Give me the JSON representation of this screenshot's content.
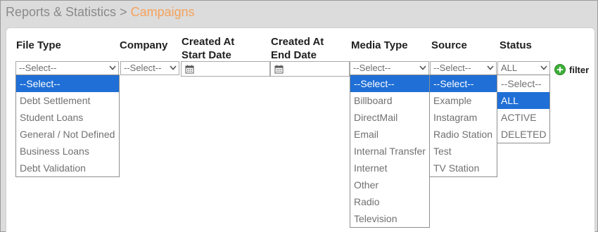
{
  "breadcrumb": {
    "parent": "Reports & Statistics",
    "separator": ">",
    "current": "Campaigns"
  },
  "columns": {
    "file_type": "File Type",
    "company": "Company",
    "created_start_line1": "Created At",
    "created_start_line2": "Start Date",
    "created_end_line1": "Created At",
    "created_end_line2": "End Date",
    "media_type": "Media Type",
    "source": "Source",
    "status": "Status"
  },
  "selects": {
    "file_type": "--Select--",
    "company": "--Select--",
    "media_type": "--Select--",
    "source": "--Select--",
    "status": "ALL"
  },
  "dropdowns": {
    "file_type": [
      "--Select--",
      "Debt Settlement",
      "Student Loans",
      "General / Not Defined",
      "Business Loans",
      "Debt Validation"
    ],
    "media_type": [
      "--Select--",
      "Billboard",
      "DirectMail",
      "Email",
      "Internal Transfer",
      "Internet",
      "Other",
      "Radio",
      "Television"
    ],
    "source": [
      "--Select--",
      "Example",
      "Instagram",
      "Radio Station",
      "Test",
      "TV Station"
    ],
    "status": [
      "--Select--",
      "ALL",
      "ACTIVE",
      "DELETED"
    ]
  },
  "filter_label": "filter",
  "colors": {
    "accent": "#f5a25b",
    "selected": "#1f6fd6",
    "filter_icon": "#3fae3a"
  }
}
